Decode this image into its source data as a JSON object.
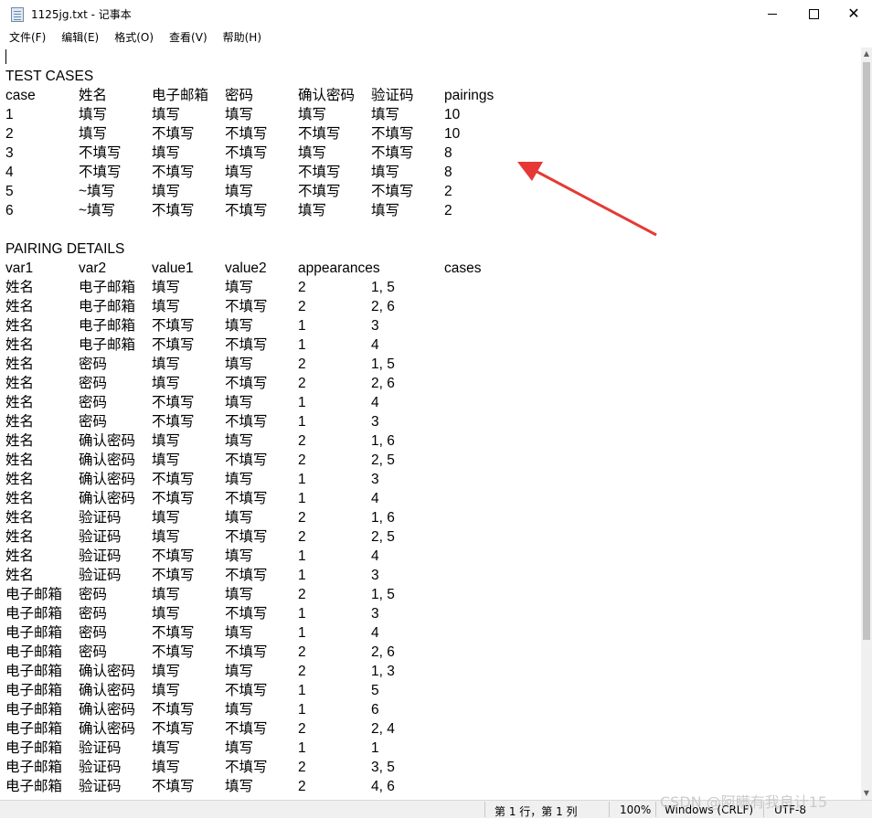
{
  "window": {
    "title": "1125jg.txt - 记事本",
    "minimize_glyph": "",
    "close_glyph": "✕"
  },
  "menu": {
    "items": [
      "文件(F)",
      "编辑(E)",
      "格式(O)",
      "查看(V)",
      "帮助(H)"
    ]
  },
  "document": {
    "test_cases_heading": "TEST CASES",
    "test_cases_header": [
      "case",
      "姓名",
      "电子邮箱",
      "密码",
      "确认密码",
      "验证码",
      "pairings"
    ],
    "test_cases_rows": [
      [
        "1",
        "填写",
        "填写",
        "填写",
        "填写",
        "填写",
        "10"
      ],
      [
        "2",
        "填写",
        "不填写",
        "不填写",
        "不填写",
        "不填写",
        "10"
      ],
      [
        "3",
        "不填写",
        "填写",
        "不填写",
        "填写",
        "不填写",
        "8"
      ],
      [
        "4",
        "不填写",
        "不填写",
        "填写",
        "不填写",
        "填写",
        "8"
      ],
      [
        "5",
        "~填写",
        "填写",
        "填写",
        "不填写",
        "不填写",
        "2"
      ],
      [
        "6",
        "~填写",
        "不填写",
        "不填写",
        "填写",
        "填写",
        "2"
      ]
    ],
    "pairing_heading": "PAIRING DETAILS",
    "pairing_header": [
      "var1",
      "var2",
      "value1",
      "value2",
      "appearances",
      "",
      "cases"
    ],
    "pairing_rows": [
      [
        "姓名",
        "电子邮箱",
        "填写",
        "填写",
        "2",
        "1, 5"
      ],
      [
        "姓名",
        "电子邮箱",
        "填写",
        "不填写",
        "2",
        "2, 6"
      ],
      [
        "姓名",
        "电子邮箱",
        "不填写",
        "填写",
        "1",
        "3"
      ],
      [
        "姓名",
        "电子邮箱",
        "不填写",
        "不填写",
        "1",
        "4"
      ],
      [
        "姓名",
        "密码",
        "填写",
        "填写",
        "2",
        "1, 5"
      ],
      [
        "姓名",
        "密码",
        "填写",
        "不填写",
        "2",
        "2, 6"
      ],
      [
        "姓名",
        "密码",
        "不填写",
        "填写",
        "1",
        "4"
      ],
      [
        "姓名",
        "密码",
        "不填写",
        "不填写",
        "1",
        "3"
      ],
      [
        "姓名",
        "确认密码",
        "填写",
        "填写",
        "2",
        "1, 6"
      ],
      [
        "姓名",
        "确认密码",
        "填写",
        "不填写",
        "2",
        "2, 5"
      ],
      [
        "姓名",
        "确认密码",
        "不填写",
        "填写",
        "1",
        "3"
      ],
      [
        "姓名",
        "确认密码",
        "不填写",
        "不填写",
        "1",
        "4"
      ],
      [
        "姓名",
        "验证码",
        "填写",
        "填写",
        "2",
        "1, 6"
      ],
      [
        "姓名",
        "验证码",
        "填写",
        "不填写",
        "2",
        "2, 5"
      ],
      [
        "姓名",
        "验证码",
        "不填写",
        "填写",
        "1",
        "4"
      ],
      [
        "姓名",
        "验证码",
        "不填写",
        "不填写",
        "1",
        "3"
      ],
      [
        "电子邮箱",
        "密码",
        "填写",
        "填写",
        "2",
        "1, 5"
      ],
      [
        "电子邮箱",
        "密码",
        "填写",
        "不填写",
        "1",
        "3"
      ],
      [
        "电子邮箱",
        "密码",
        "不填写",
        "填写",
        "1",
        "4"
      ],
      [
        "电子邮箱",
        "密码",
        "不填写",
        "不填写",
        "2",
        "2, 6"
      ],
      [
        "电子邮箱",
        "确认密码",
        "填写",
        "填写",
        "2",
        "1, 3"
      ],
      [
        "电子邮箱",
        "确认密码",
        "填写",
        "不填写",
        "1",
        "5"
      ],
      [
        "电子邮箱",
        "确认密码",
        "不填写",
        "填写",
        "1",
        "6"
      ],
      [
        "电子邮箱",
        "确认密码",
        "不填写",
        "不填写",
        "2",
        "2, 4"
      ],
      [
        "电子邮箱",
        "验证码",
        "填写",
        "填写",
        "1",
        "1"
      ],
      [
        "电子邮箱",
        "验证码",
        "填写",
        "不填写",
        "2",
        "3, 5"
      ],
      [
        "电子邮箱",
        "验证码",
        "不填写",
        "填写",
        "2",
        "4, 6"
      ]
    ]
  },
  "statusbar": {
    "position": "第 1 行，第 1 列",
    "zoom": "100%",
    "line_ending": "Windows (CRLF)",
    "encoding": "UTF-8"
  },
  "watermark": "CSDN @阿瞒有我良计15",
  "colors": {
    "annotation_arrow": "#e53935"
  }
}
